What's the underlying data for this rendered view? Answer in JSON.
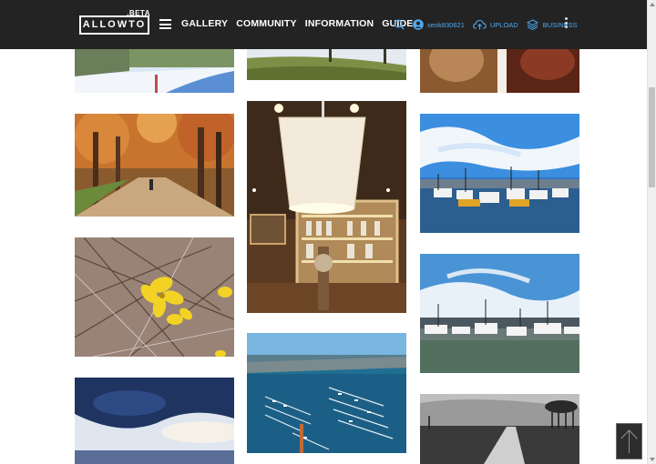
{
  "header": {
    "logo_text": "ALLOWTO",
    "logo_badge": ".BETA",
    "menu_icon": "hamburger-icon",
    "nav": [
      "GALLERY",
      "COMMUNITY",
      "INFORMATION",
      "GUIDE"
    ],
    "search_icon": "search-icon",
    "user_icon": "user-icon",
    "username": "seok830621",
    "upload_icon": "cloud-upload-icon",
    "upload_label": "UPLOAD",
    "business_icon": "layers-icon",
    "business_label": "BUSINESS",
    "more_icon": "kebab-menu-icon"
  },
  "colors": {
    "header_bg": "#232323",
    "accent": "#4fa9f0",
    "page_bg": "#ffffff"
  },
  "gallery": {
    "photos": [
      "snowy-park-path",
      "grassy-hill",
      "cafe-cups-closeup",
      "autumn-tree-lined-path",
      "lamp-in-cafe-shop",
      "harbor-boats-blue-sky",
      "yellow-forsythia-flower",
      "fishing-boats-at-port",
      "stormy-clouds-sky",
      "aerial-marina",
      "black-and-white-field-road"
    ]
  },
  "back_to_top_icon": "arrow-up-icon"
}
